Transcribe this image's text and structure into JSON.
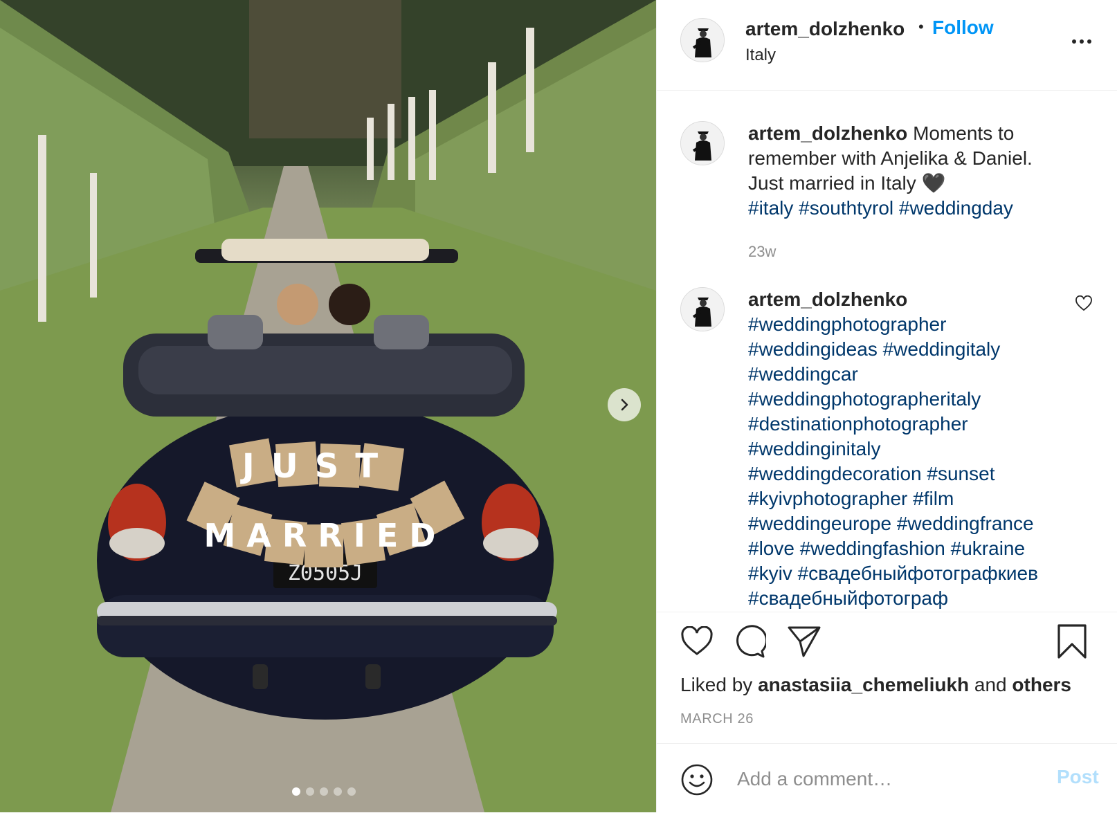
{
  "post": {
    "username": "artem_dolzhenko",
    "follow_label": "Follow",
    "bullet": "•",
    "location": "Italy"
  },
  "photo": {
    "sign_just": "JUST",
    "sign_married": "MARRIED",
    "plate": "Z0505J",
    "slide_count": 5,
    "active_slide": 1
  },
  "caption": {
    "username": "artem_dolzhenko",
    "text": "Moments to remember with Anjelika & Daniel. Just married in Italy 🖤",
    "hashtags": "#italy #southtyrol #weddingday",
    "time": "23w"
  },
  "comment": {
    "username": "artem_dolzhenko",
    "hashtags": [
      "#weddingphotographer",
      "#weddingideas #weddingitaly",
      "#weddingcar",
      "#weddingphotographeritaly",
      "#destinationphotographer",
      "#weddinginitaly",
      "#weddingdecoration #sunset",
      "#kyivphotographer #film",
      "#weddingeurope #weddingfrance",
      "#love #weddingfashion #ukraine",
      "#kyiv #свадебныйфотографкиев",
      "#свадебныйфотограф"
    ]
  },
  "likes": {
    "prefix": "Liked by",
    "user": "anastasiia_chemeliukh",
    "and": "and",
    "others": "others"
  },
  "date": "MARCH 26",
  "add_comment": {
    "placeholder": "Add a comment…",
    "post_label": "Post"
  },
  "icons": [
    "next-arrow-icon",
    "more-options-icon",
    "heart-icon",
    "comment-icon",
    "share-icon",
    "bookmark-icon",
    "emoji-icon",
    "small-heart-icon"
  ],
  "colors": {
    "follow": "#0095f6",
    "hashtag": "#00376b",
    "muted": "#8e8e8e",
    "post_disabled": "#b2dffc"
  }
}
